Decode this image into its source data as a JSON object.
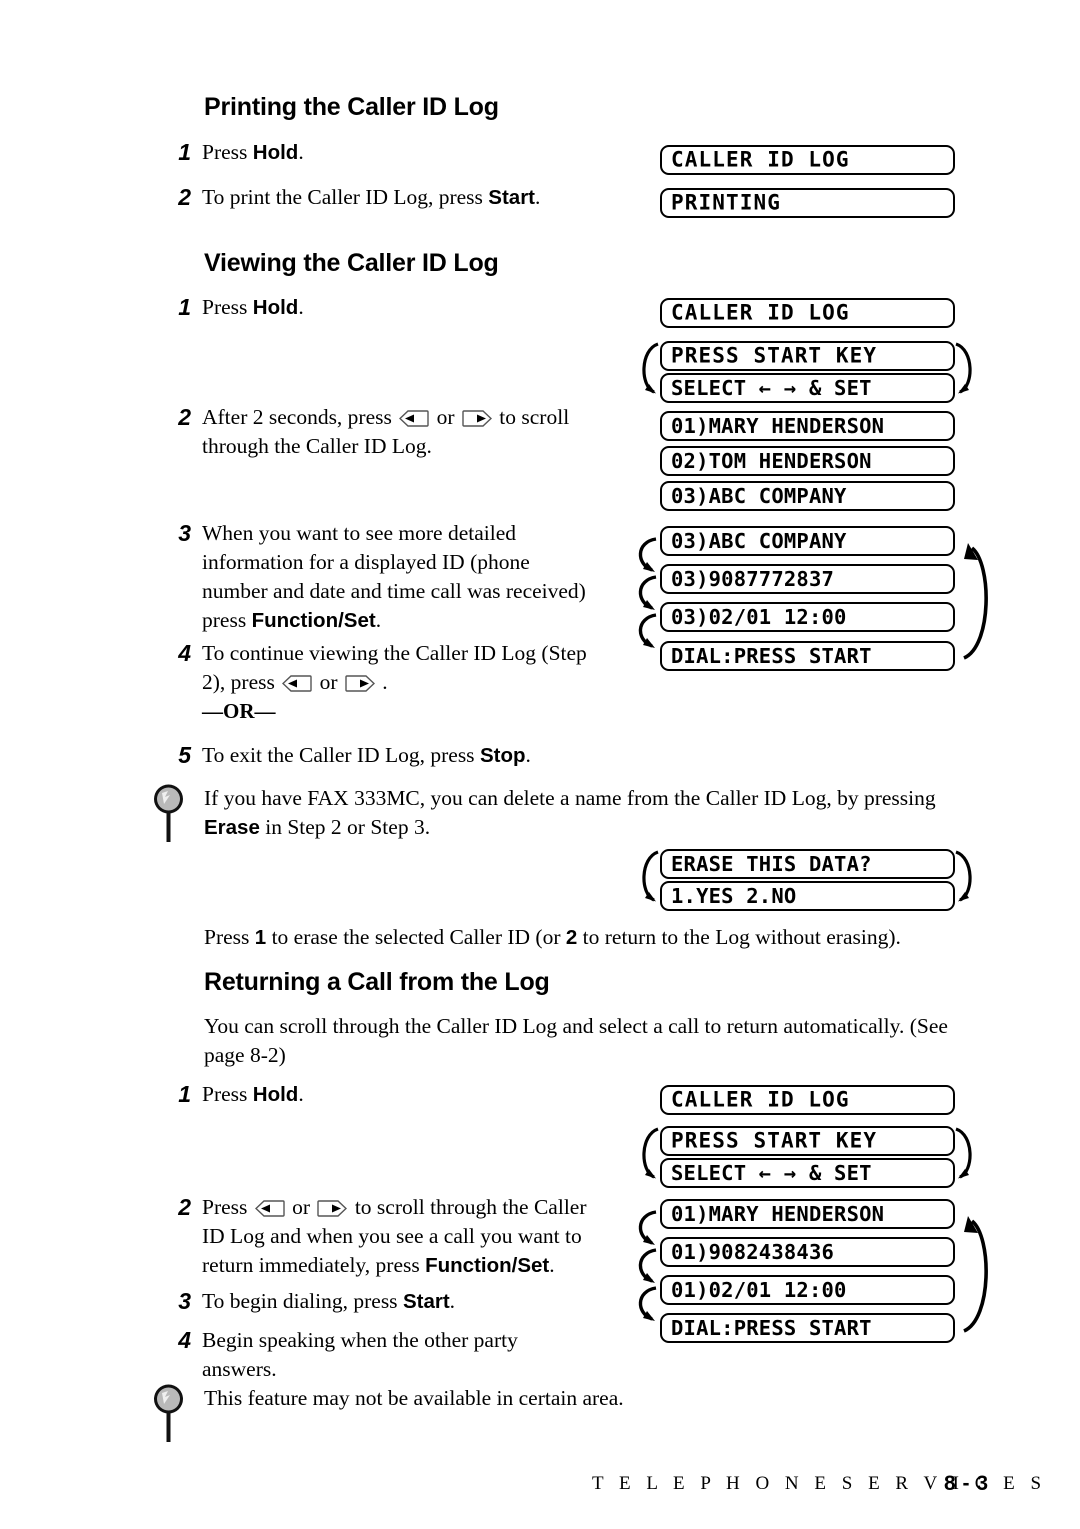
{
  "sections": {
    "printing": {
      "heading": "Printing the Caller ID Log",
      "steps": [
        {
          "num": "1",
          "text_before": "Press ",
          "bold": "Hold",
          "text_after": "."
        },
        {
          "num": "2",
          "text_before": "To print the Caller ID Log, press ",
          "bold": "Start",
          "text_after": "."
        }
      ],
      "displays": [
        {
          "text": "CALLER ID LOG"
        },
        {
          "text": "PRINTING"
        }
      ]
    },
    "viewing": {
      "heading": "Viewing the Caller ID Log",
      "step1": {
        "num": "1",
        "text_before": "Press ",
        "bold": "Hold",
        "text_after": "."
      },
      "step2": {
        "num": "2",
        "part1": "After 2 seconds, press ",
        "key_left": "left-arrow-key",
        "mid": " or ",
        "key_right": "right-arrow-key",
        "part2": " to scroll",
        "line2": "through the Caller ID Log."
      },
      "step3": {
        "num": "3",
        "line1": "When you want to see more detailed",
        "line2": "information for a displayed ID (phone",
        "line3": "number and date and time call was received)",
        "line4_before": "press ",
        "line4_bold": "Function/Set",
        "line4_after": "."
      },
      "step4": {
        "num": "4",
        "line1": "To continue viewing the Caller ID Log (Step",
        "line2_a": "2), press ",
        "key_left": "left-arrow-key",
        "line2_mid": " or ",
        "key_right": "right-arrow-key",
        "line2_b": " .",
        "or": "—OR—"
      },
      "step5": {
        "num": "5",
        "text_before": "To exit the Caller ID Log, press ",
        "bold": "Stop",
        "text_after": "."
      },
      "displays_top": [
        {
          "text": "CALLER ID LOG"
        },
        {
          "text": "PRESS START KEY"
        },
        {
          "text": "SELECT ← → & SET"
        }
      ],
      "displays_list": [
        {
          "text": "01)MARY HENDERSON"
        },
        {
          "text": "02)TOM HENDERSON"
        },
        {
          "text": "03)ABC COMPANY"
        }
      ],
      "displays_detail": [
        {
          "text": "03)ABC COMPANY"
        },
        {
          "text": "03)9087772837"
        },
        {
          "text": "03)02/01 12:00"
        },
        {
          "text": "DIAL:PRESS START"
        }
      ]
    },
    "erase_note": {
      "line1_a": "If you have FAX 333MC, you can delete a name from the Caller ID Log, by pressing",
      "line2_bold": "Erase",
      "line2_after": " in Step 2 or Step 3.",
      "displays": [
        {
          "text": "ERASE THIS DATA?"
        },
        {
          "text": "1.YES 2.NO"
        }
      ],
      "footer_text_a": "Press ",
      "footer_bold_1": "1",
      "footer_text_b": " to erase the selected Caller ID (or ",
      "footer_bold_2": "2",
      "footer_text_c": " to return to the Log without erasing)."
    },
    "returning": {
      "heading": "Returning a Call from the Log",
      "intro_line1": "You can scroll through the Caller ID Log and select a call to return automatically.  (See",
      "intro_line2": "page 8-2)",
      "step1": {
        "num": "1",
        "text_before": "Press ",
        "bold": "Hold",
        "text_after": "."
      },
      "step2": {
        "num": "2",
        "part1": "Press ",
        "key_left": "left-arrow-key",
        "mid": " or ",
        "key_right": "right-arrow-key",
        "part2": " to scroll through the Caller",
        "line2": "ID Log and when you see a call you want to",
        "line3_before": "return immediately, press ",
        "line3_bold": "Function/Set",
        "line3_after": "."
      },
      "step3": {
        "num": "3",
        "text_before": "To begin dialing, press ",
        "bold": "Start",
        "text_after": "."
      },
      "step4": {
        "num": "4",
        "line1": "Begin speaking when the other party",
        "line2": "answers."
      },
      "note": "This feature may not be available in certain area.",
      "displays_top": [
        {
          "text": "CALLER ID LOG"
        },
        {
          "text": "PRESS START KEY"
        },
        {
          "text": "SELECT ← → & SET"
        }
      ],
      "displays_detail": [
        {
          "text": "01)MARY HENDERSON"
        },
        {
          "text": "01)9082438436"
        },
        {
          "text": "01)02/01 12:00"
        },
        {
          "text": "DIAL:PRESS START"
        }
      ]
    }
  },
  "footer": {
    "title": "T E L E P H O N E   S E R V I C E S",
    "page": "8 - 3"
  },
  "colors": {
    "text": "#000000",
    "background": "#ffffff",
    "icon_fill": "#b0b0b0"
  }
}
